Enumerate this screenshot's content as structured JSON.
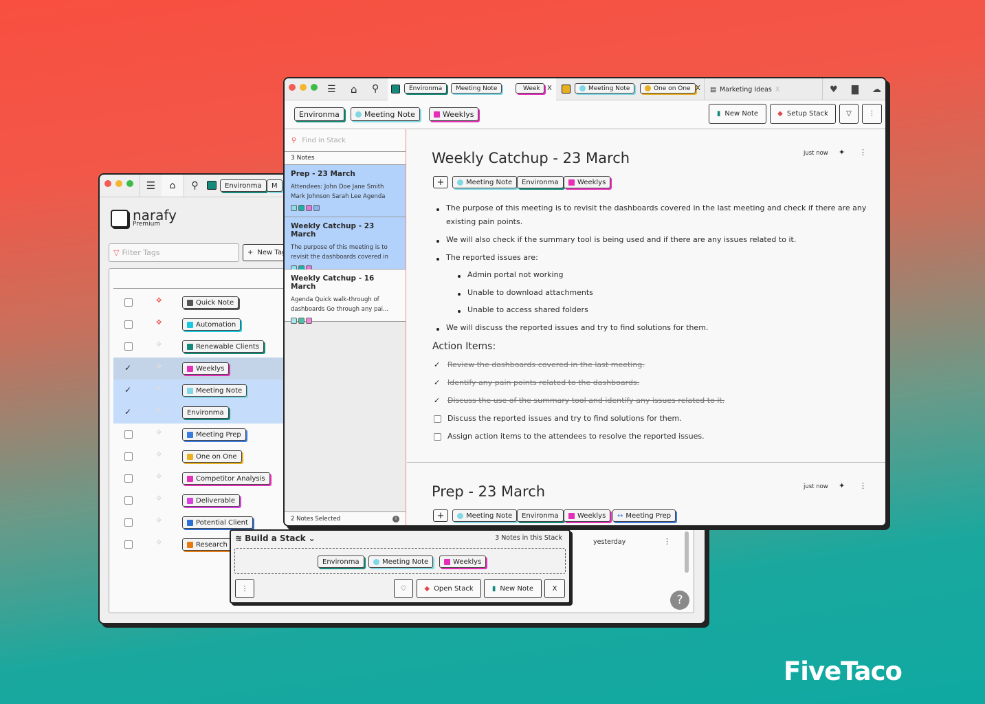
{
  "colors": {
    "environma": "#138a7a",
    "meeting_note": "#7fd8e4",
    "weeklys": "#e62fb8",
    "meeting_prep": "#3a7be0",
    "one_on_one": "#e8b020",
    "competitor": "#e62fb8",
    "deliverable": "#d940e0",
    "potential": "#2a6fd8",
    "research": "#e87b10",
    "quick": "#555555",
    "automation": "#1ac8e0",
    "renewable": "#138a7a",
    "selected_row": "#c5dcfa",
    "selected_note": "#b3d2fb"
  },
  "back_window": {
    "tabs": [
      "Environma",
      "M"
    ],
    "logo": {
      "name": "narafy",
      "tier": "Premium"
    },
    "filter_placeholder": "Filter Tags",
    "new_tag_label": "New Tag",
    "tags": [
      {
        "label": "Quick Note",
        "icon": "note-icon",
        "color": "#555555",
        "pinned": true,
        "checked": false
      },
      {
        "label": "Automation",
        "icon": "code-icon",
        "color": "#1ac8e0",
        "pinned": true,
        "checked": false
      },
      {
        "label": "Renewable Clients",
        "icon": "palm-icon",
        "color": "#138a7a",
        "pinned": false,
        "checked": false
      },
      {
        "label": "Weeklys",
        "icon": "calendar-icon",
        "color": "#e62fb8",
        "pinned": false,
        "checked": true
      },
      {
        "label": "Meeting Note",
        "icon": "paperclip-icon",
        "color": "#7fd8e4",
        "pinned": false,
        "checked": true
      },
      {
        "label": "Environma",
        "icon": "",
        "color": "#138a7a",
        "pinned": false,
        "checked": true
      },
      {
        "label": "Meeting Prep",
        "icon": "arrows-icon",
        "color": "#3a7be0",
        "pinned": false,
        "checked": false
      },
      {
        "label": "One on One",
        "icon": "person-icon",
        "color": "#e8b020",
        "pinned": false,
        "checked": false
      },
      {
        "label": "Competitor Analysis",
        "icon": "question-icon",
        "color": "#e62fb8",
        "pinned": false,
        "checked": false
      },
      {
        "label": "Deliverable",
        "icon": "square-icon",
        "color": "#d940e0",
        "pinned": false,
        "checked": false
      },
      {
        "label": "Potential Client",
        "icon": "bolt-icon",
        "color": "#2a6fd8",
        "pinned": false,
        "checked": false
      },
      {
        "label": "Research",
        "icon": "globe-icon",
        "color": "#e87b10",
        "pinned": false,
        "checked": false
      }
    ],
    "yesterday": "yesterday",
    "help": "?"
  },
  "front_window": {
    "tabs": [
      {
        "tags": [
          "Environma",
          "Meeting Note",
          "Week"
        ],
        "close": "X"
      },
      {
        "tags": [
          "Meeting Note",
          "One on One"
        ],
        "close": "X"
      },
      {
        "label": "Marketing Ideas",
        "close": "X"
      }
    ],
    "stack_tags": [
      "Environma",
      "Meeting Note",
      "Weeklys"
    ],
    "new_note": "New Note",
    "setup_stack": "Setup Stack",
    "search_placeholder": "Find in Stack",
    "notes_count": "3 Notes",
    "notes": [
      {
        "title": "Prep - 23 March",
        "excerpt": "Attendees: John Doe Jane Smith Mark Johnson Sarah Lee  Agenda Revisit",
        "swatches": [
          "#8fdcec",
          "#19b0a8",
          "#e07ad8",
          "#86b4f2"
        ],
        "selected": true
      },
      {
        "title": "Weekly Catchup - 23 March",
        "excerpt": "The purpose of this meeting is to revisit the dashboards covered in th...",
        "swatches": [
          "#8fdcec",
          "#19b0a8",
          "#e07ad8"
        ],
        "selected": true
      },
      {
        "title": "Weekly Catchup - 16 March",
        "excerpt": "Agenda Quick walk-through of dashboards Go through any pai...",
        "swatches": [
          "#a8e8ec",
          "#4dbfa8",
          "#f08ad8"
        ],
        "selected": false
      }
    ],
    "selected_status": "2 Notes Selected",
    "note1": {
      "title": "Weekly Catchup - 23 March",
      "time": "just now",
      "tags": [
        "Meeting Note",
        "Environma",
        "Weeklys"
      ],
      "bullets": [
        "The purpose of this meeting is to revisit the dashboards covered in the last meeting and check if there are any",
        "existing pain points.",
        "We will also check if the summary tool is being used and if there are any issues related to it.",
        "The reported issues are:",
        "Admin portal not working",
        "Unable to download attachments",
        "Unable to access shared folders",
        "We will discuss the reported issues and try to find solutions for them."
      ],
      "action_heading": "Action Items:",
      "actions": [
        {
          "text": "Review the dashboards covered in the last meeting.",
          "done": true
        },
        {
          "text": "Identify any pain points related to the dashboards.",
          "done": true
        },
        {
          "text": "Discuss the use of the summary tool and identify any issues related to it.",
          "done": true
        },
        {
          "text": "Discuss the reported issues and try to find solutions for them.",
          "done": false
        },
        {
          "text": "Assign action items to the attendees to resolve the reported issues.",
          "done": false
        }
      ]
    },
    "note2": {
      "title": "Prep - 23 March",
      "time": "just now",
      "tags": [
        "Meeting Note",
        "Environma",
        "Weeklys",
        "Meeting Prep"
      ]
    }
  },
  "stack_popup": {
    "title": "Build a Stack",
    "count": "3 Notes in this Stack",
    "tags": [
      "Environma",
      "Meeting Note",
      "Weeklys"
    ],
    "open_stack": "Open Stack",
    "new_note": "New Note",
    "close": "X"
  },
  "brand": "FiveTaco"
}
